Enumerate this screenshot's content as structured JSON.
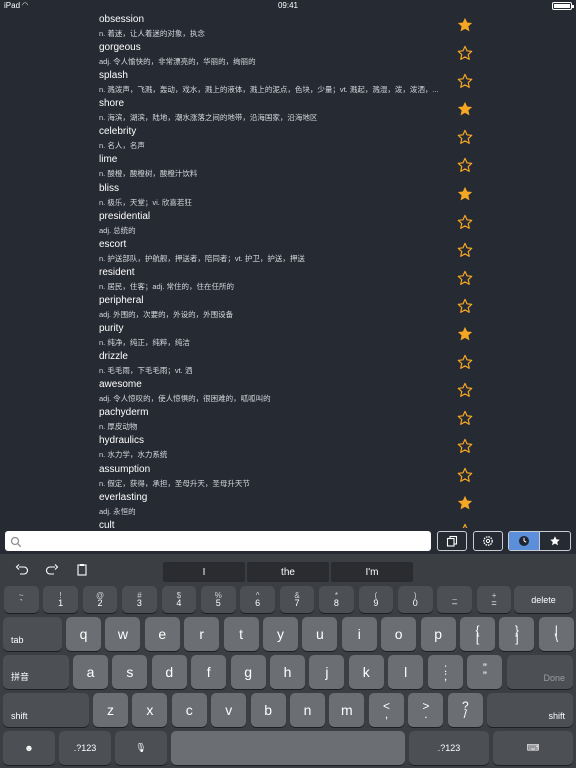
{
  "status_bar": {
    "carrier": "iPad",
    "time": "09:41",
    "battery_level": 0.9
  },
  "words": [
    {
      "word": "obsession",
      "definition": "n. 着迷，让人着迷的对象，执念",
      "starred": true
    },
    {
      "word": "gorgeous",
      "definition": "adj. 令人愉快的，非常漂亮的，华丽的，绚丽的",
      "starred": false
    },
    {
      "word": "splash",
      "definition": "n. 溅泼声，飞溅，轰动，戏水，溅上的液体，溅上的泥点，色块，少量；vt. 溅起，溅湿，泼，泼洒，...",
      "starred": false
    },
    {
      "word": "shore",
      "definition": "n. 海滨，湖滨，陆地，潮水涨落之间的地带，沿海国家，沿海地区",
      "starred": true
    },
    {
      "word": "celebrity",
      "definition": "n. 名人，名声",
      "starred": false
    },
    {
      "word": "lime",
      "definition": "n. 酸橙，酸橙树，酸橙汁饮料",
      "starred": false
    },
    {
      "word": "bliss",
      "definition": "n. 极乐，天堂；vi. 欣喜若狂",
      "starred": true
    },
    {
      "word": "presidential",
      "definition": "adj. 总统的",
      "starred": false
    },
    {
      "word": "escort",
      "definition": "n. 护送部队，护航舰，押送者，陪同者；vt. 护卫，护送，押送",
      "starred": false
    },
    {
      "word": "resident",
      "definition": "n. 居民，住客；adj. 常住的，住在任所的",
      "starred": false
    },
    {
      "word": "peripheral",
      "definition": "adj. 外围的，次要的，外设的，外围设备",
      "starred": false
    },
    {
      "word": "purity",
      "definition": "n. 纯净，纯正，纯粹，纯洁",
      "starred": true
    },
    {
      "word": "drizzle",
      "definition": "n. 毛毛雨，下毛毛雨；vt. 洒",
      "starred": false
    },
    {
      "word": "awesome",
      "definition": "adj. 令人惊叹的，使人惊惧的，很困难的，呱呱叫的",
      "starred": false
    },
    {
      "word": "pachyderm",
      "definition": "n. 厚皮动物",
      "starred": false
    },
    {
      "word": "hydraulics",
      "definition": "n. 水力学，水力系统",
      "starred": false
    },
    {
      "word": "assumption",
      "definition": "n. 假定，获得，承担，圣母升天，圣母升天节",
      "starred": false
    },
    {
      "word": "everlasting",
      "definition": "adj. 永恒的",
      "starred": true
    },
    {
      "word": "cult",
      "definition": "",
      "starred": false
    }
  ],
  "search": {
    "value": "",
    "placeholder": ""
  },
  "colors": {
    "star_filled": "#f5a623",
    "star_outline": "#f5a623",
    "segment_active": "#5b8fd9",
    "background": "#262a33"
  },
  "toolbar": {
    "copy_icon": "copy-icon",
    "settings_icon": "settings-icon",
    "history_icon": "clock-icon",
    "favorites_icon": "star-icon"
  },
  "keyboard": {
    "suggestions": [
      "I",
      "the",
      "I'm"
    ],
    "number_row": [
      {
        "top": "~",
        "bottom": "`"
      },
      {
        "top": "!",
        "bottom": "1"
      },
      {
        "top": "@",
        "bottom": "2"
      },
      {
        "top": "#",
        "bottom": "3"
      },
      {
        "top": "$",
        "bottom": "4"
      },
      {
        "top": "%",
        "bottom": "5"
      },
      {
        "top": "^",
        "bottom": "6"
      },
      {
        "top": "&",
        "bottom": "7"
      },
      {
        "top": "*",
        "bottom": "8"
      },
      {
        "top": "(",
        "bottom": "9"
      },
      {
        "top": ")",
        "bottom": "0"
      },
      {
        "top": "_",
        "bottom": "–"
      },
      {
        "top": "+",
        "bottom": "="
      }
    ],
    "delete": "delete",
    "tab": "tab",
    "row1": [
      "q",
      "w",
      "e",
      "r",
      "t",
      "y",
      "u",
      "i",
      "o",
      "p"
    ],
    "row1_punct": [
      {
        "top": "{",
        "bottom": "["
      },
      {
        "top": "}",
        "bottom": "]"
      },
      {
        "top": "|",
        "bottom": "\\"
      }
    ],
    "pinyin": "拼音",
    "row2": [
      "a",
      "s",
      "d",
      "f",
      "g",
      "h",
      "j",
      "k",
      "l"
    ],
    "row2_punct": [
      {
        "top": ":",
        "bottom": ";"
      },
      {
        "top": "”",
        "bottom": "”"
      }
    ],
    "done": "Done",
    "shift_left": "shift",
    "row3": [
      "z",
      "x",
      "c",
      "v",
      "b",
      "n",
      "m"
    ],
    "row3_punct": [
      {
        "top": "<",
        "bottom": ","
      },
      {
        "top": ">",
        "bottom": "."
      },
      {
        "top": "?",
        "bottom": "/"
      }
    ],
    "shift_right": "shift",
    "emoji": "☻",
    "numbers_left": ".?123",
    "numbers_right": ".?123"
  }
}
